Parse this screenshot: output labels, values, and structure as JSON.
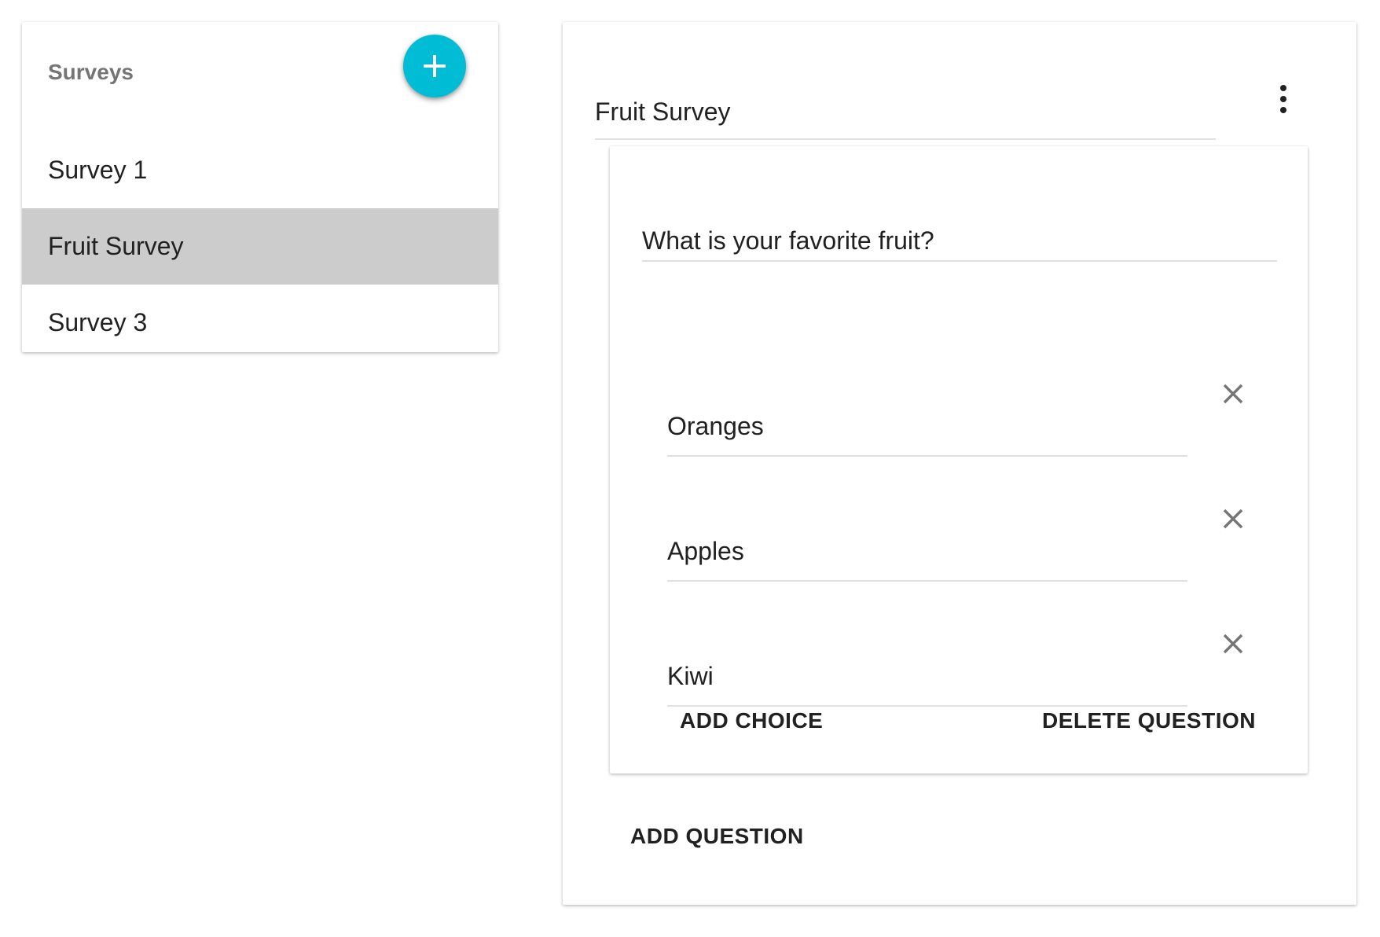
{
  "surveys_panel": {
    "title": "Surveys",
    "add_icon": "plus-icon",
    "fab_color": "#00bcd4",
    "items": [
      {
        "label": "Survey 1",
        "selected": false
      },
      {
        "label": "Fruit Survey",
        "selected": true
      },
      {
        "label": "Survey 3",
        "selected": false
      }
    ]
  },
  "editor": {
    "survey_title": "Fruit Survey",
    "menu_icon": "more-vert-icon",
    "question": {
      "text": "What is your favorite fruit?",
      "choices": [
        {
          "label": "Oranges",
          "remove_icon": "close-icon"
        },
        {
          "label": "Apples",
          "remove_icon": "close-icon"
        },
        {
          "label": "Kiwi",
          "remove_icon": "close-icon"
        }
      ],
      "add_choice_label": "ADD CHOICE",
      "delete_question_label": "DELETE QUESTION"
    },
    "add_question_label": "ADD QUESTION"
  },
  "colors": {
    "accent": "#00bcd4",
    "selected_row": "#cccccc",
    "muted_text": "#757575",
    "icon_gray": "#757575"
  }
}
